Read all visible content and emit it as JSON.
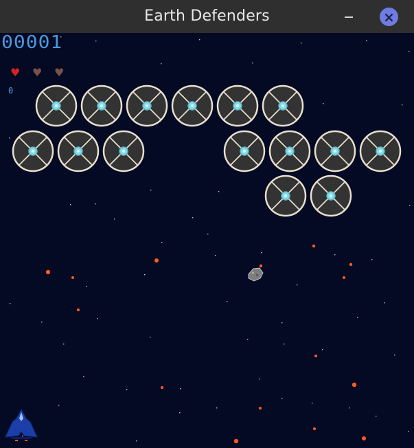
{
  "window": {
    "title": "Earth Defenders"
  },
  "controls": {
    "minimize_label": "—",
    "close_label": "×"
  },
  "hud": {
    "score": "00001",
    "level": "0",
    "lives": {
      "total": 3,
      "remaining": 1,
      "full_color": "#d52121",
      "empty_color": "#7a5146",
      "icon": "heart-icon"
    }
  },
  "colors": {
    "background": "#050a24",
    "enemy_fill": "#333333",
    "enemy_outline": "#e8e0ce",
    "enemy_core": "#89d8e5",
    "enemy_core_outline": "#53b7c9",
    "player": "#1b3ea8",
    "player_cockpit": "#9ec5ff",
    "projectile": "#ff5a1f",
    "star": "#ffffff"
  },
  "enemies": {
    "icon": "enemy-disc-icon",
    "rows": [
      6,
      7,
      2
    ],
    "count": 15
  },
  "player": {
    "icon": "player-ship-icon"
  },
  "asteroid": {
    "icon": "asteroid-icon"
  }
}
